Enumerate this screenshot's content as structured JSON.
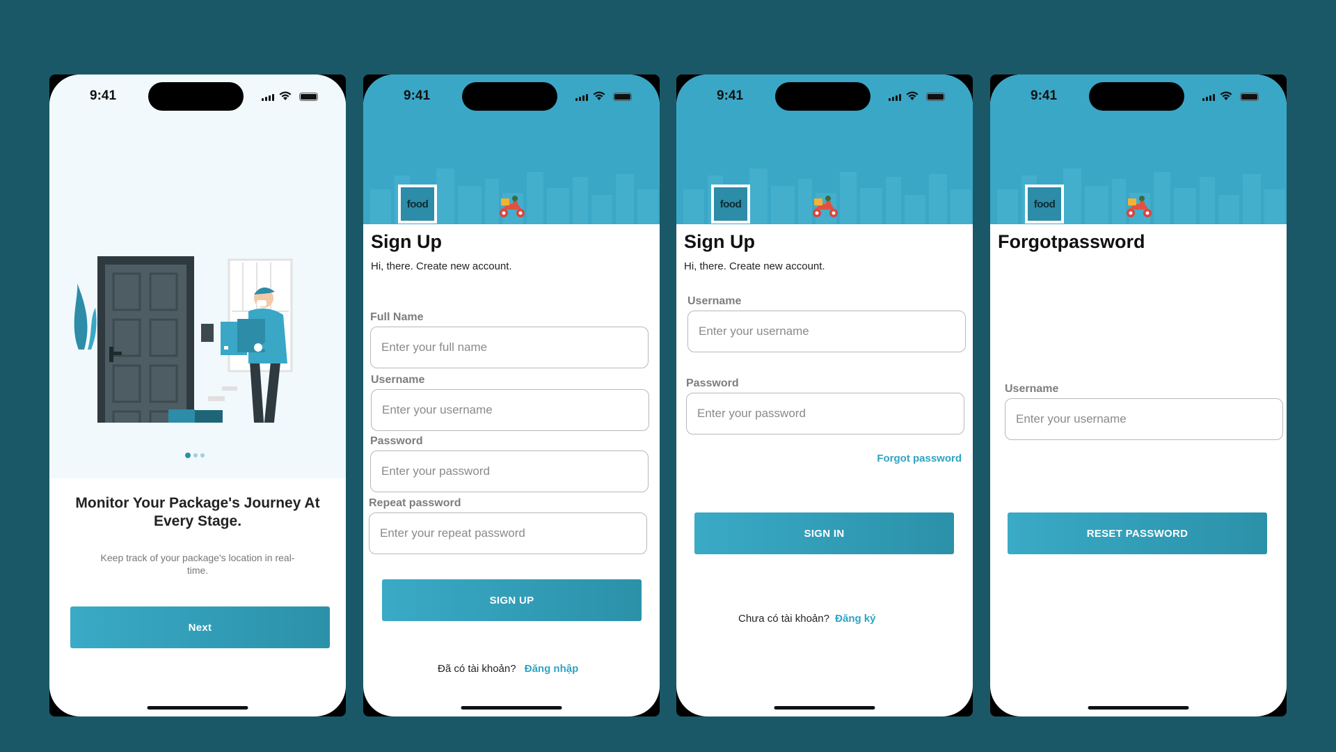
{
  "status": {
    "time": "9:41"
  },
  "onboarding": {
    "title": "Monitor Your Package's Journey At Every Stage.",
    "subtitle": "Keep track of your package's location in real-time.",
    "next_label": "Next"
  },
  "logo_text": "food",
  "signup": {
    "title": "Sign Up",
    "subtitle": "Hi, there. Create new account.",
    "fields": [
      {
        "label": "Full Name",
        "placeholder": "Enter your full name"
      },
      {
        "label": "Username",
        "placeholder": "Enter your username"
      },
      {
        "label": "Password",
        "placeholder": "Enter your password"
      },
      {
        "label": "Repeat password",
        "placeholder": "Enter your repeat password"
      }
    ],
    "button_label": "SIGN UP",
    "have_account_text": "Đã có tài khoản?",
    "login_link": "Đăng nhập"
  },
  "signin": {
    "title": "Sign Up",
    "subtitle": "Hi, there. Create new account.",
    "fields": [
      {
        "label": "Username",
        "placeholder": "Enter your username"
      },
      {
        "label": "Password",
        "placeholder": "Enter your password"
      }
    ],
    "forgot_link": "Forgot password",
    "button_label": "SIGN IN",
    "no_account_text": "Chưa có tài khoản?",
    "register_link": "Đăng ký"
  },
  "forgot": {
    "title": "Forgotpassword",
    "fields": [
      {
        "label": "Username",
        "placeholder": "Enter your username"
      }
    ],
    "button_label": "RESET PASSWORD"
  },
  "colors": {
    "background": "#1a5868",
    "accent": "#3aa7c7",
    "link": "#2fa3c4"
  },
  "icons": [
    "cellular-signal-icon",
    "wifi-icon",
    "battery-icon",
    "scooter-icon"
  ]
}
